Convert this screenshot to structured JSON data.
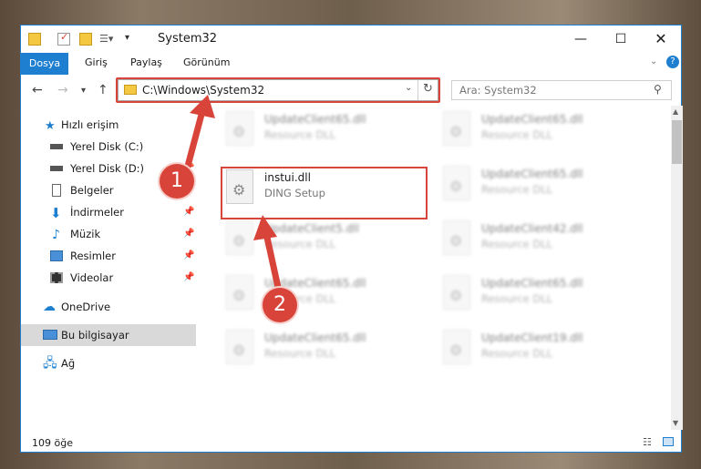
{
  "window": {
    "title": "System32"
  },
  "ribbon": {
    "tabs": [
      "Dosya",
      "Giriş",
      "Paylaş",
      "Görünüm"
    ]
  },
  "address": {
    "path": "C:\\Windows\\System32",
    "search_placeholder": "Ara: System32"
  },
  "nav": {
    "items": [
      {
        "label": "Hızlı erişim",
        "icon": "star-icon"
      },
      {
        "label": "Yerel Disk (C:)",
        "icon": "drive-icon"
      },
      {
        "label": "Yerel Disk (D:)",
        "icon": "drive-icon"
      },
      {
        "label": "Belgeler",
        "icon": "document-icon"
      },
      {
        "label": "İndirmeler",
        "icon": "download-icon"
      },
      {
        "label": "Müzik",
        "icon": "music-icon"
      },
      {
        "label": "Resimler",
        "icon": "pictures-icon"
      },
      {
        "label": "Videolar",
        "icon": "video-icon"
      },
      {
        "label": "OneDrive",
        "icon": "cloud-icon"
      },
      {
        "label": "Bu bilgisayar",
        "icon": "computer-icon"
      },
      {
        "label": "Ağ",
        "icon": "network-icon"
      }
    ]
  },
  "files": {
    "highlighted": {
      "name": "instui.dll",
      "desc": "DING Setup"
    },
    "blurred": [
      {
        "name": "UpdateClient65.dll",
        "desc": "Resource DLL"
      },
      {
        "name": "UpdateClient65.dll",
        "desc": "Resource DLL"
      },
      {
        "name": "UpdateClient65.dll",
        "desc": "Resource DLL"
      },
      {
        "name": "UpdateClient5.dll",
        "desc": "Resource DLL"
      },
      {
        "name": "UpdateClient42.dll",
        "desc": "Resource DLL"
      },
      {
        "name": "UpdateClient65.dll",
        "desc": "Resource DLL"
      },
      {
        "name": "UpdateClient65.dll",
        "desc": "Resource DLL"
      },
      {
        "name": "UpdateClient65.dll",
        "desc": "Resource DLL"
      },
      {
        "name": "UpdateClient19.dll",
        "desc": "Resource DLL"
      }
    ]
  },
  "status": {
    "count": "109 öğe"
  },
  "annotations": {
    "badge1": "1",
    "badge2": "2"
  },
  "colors": {
    "accent": "#1e7fd0",
    "highlight": "#d9443a"
  }
}
